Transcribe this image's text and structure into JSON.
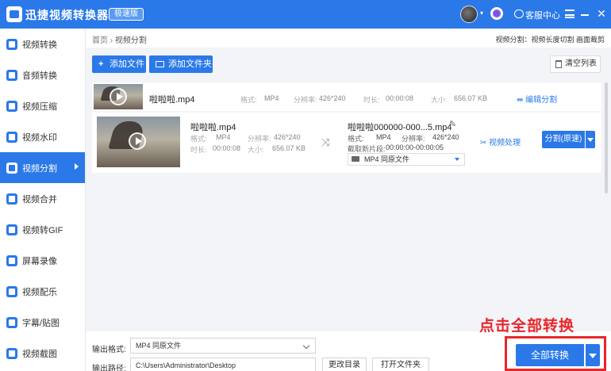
{
  "titlebar": {
    "app_title": "迅捷视频转换器",
    "badge": "极速版",
    "service_label": "客服中心"
  },
  "sidebar": {
    "items": [
      {
        "label": "视频转换"
      },
      {
        "label": "音频转换"
      },
      {
        "label": "视频压缩"
      },
      {
        "label": "视频水印"
      },
      {
        "label": "视频分割",
        "active": true
      },
      {
        "label": "视频合并"
      },
      {
        "label": "视频转GIF"
      },
      {
        "label": "屏幕录像"
      },
      {
        "label": "视频配乐"
      },
      {
        "label": "字幕/贴图"
      },
      {
        "label": "视频截图"
      }
    ]
  },
  "breadcrumb": {
    "home": "首页",
    "sep": "›",
    "current": "视频分割"
  },
  "top_hint": "视频分割：视频长度切割 画面裁剪",
  "toolbar": {
    "add_file": "添加文件",
    "add_folder": "添加文件夹",
    "clear_list": "清空列表"
  },
  "file1": {
    "name": "啦啦啦.mp4",
    "format_label": "格式:",
    "format": "MP4",
    "res_label": "分辨率:",
    "res": "426*240",
    "dur_label": "时长:",
    "dur": "00:00:08",
    "size_label": "大小:",
    "size": "656.07 KB",
    "edit_label": "编辑分割"
  },
  "file2": {
    "name": "啦啦啦.mp4",
    "format_label": "格式:",
    "format": "MP4",
    "res_label": "分辨率:",
    "res": "426*240",
    "dur_label": "时长:",
    "dur": "00:00:08",
    "size_label": "大小:",
    "size": "656.07 KB",
    "out_name": "啦啦啦000000-000...5.mp4",
    "out_format_label": "格式:",
    "out_format": "MP4",
    "out_res_label": "分辨率:",
    "out_res": "426*240",
    "clip_label": "截取新片段:",
    "clip_range": "00:00:00-00:00:05",
    "out_select": "MP4  同原文件",
    "process_label": "视频处理",
    "split_btn": "分割(原速)"
  },
  "bottom": {
    "format_label": "输出格式:",
    "format_value": "MP4  同原文件",
    "path_label": "输出路径:",
    "path_value": "C:\\Users\\Administrator\\Desktop",
    "change_dir": "更改目录",
    "open_folder": "打开文件夹",
    "convert_all": "全部转换"
  },
  "annotation": {
    "text": "点击全部转换",
    "color": "#e8262a"
  },
  "colors": {
    "accent": "#2b79e8",
    "panel_bg": "#f3f4f7"
  }
}
